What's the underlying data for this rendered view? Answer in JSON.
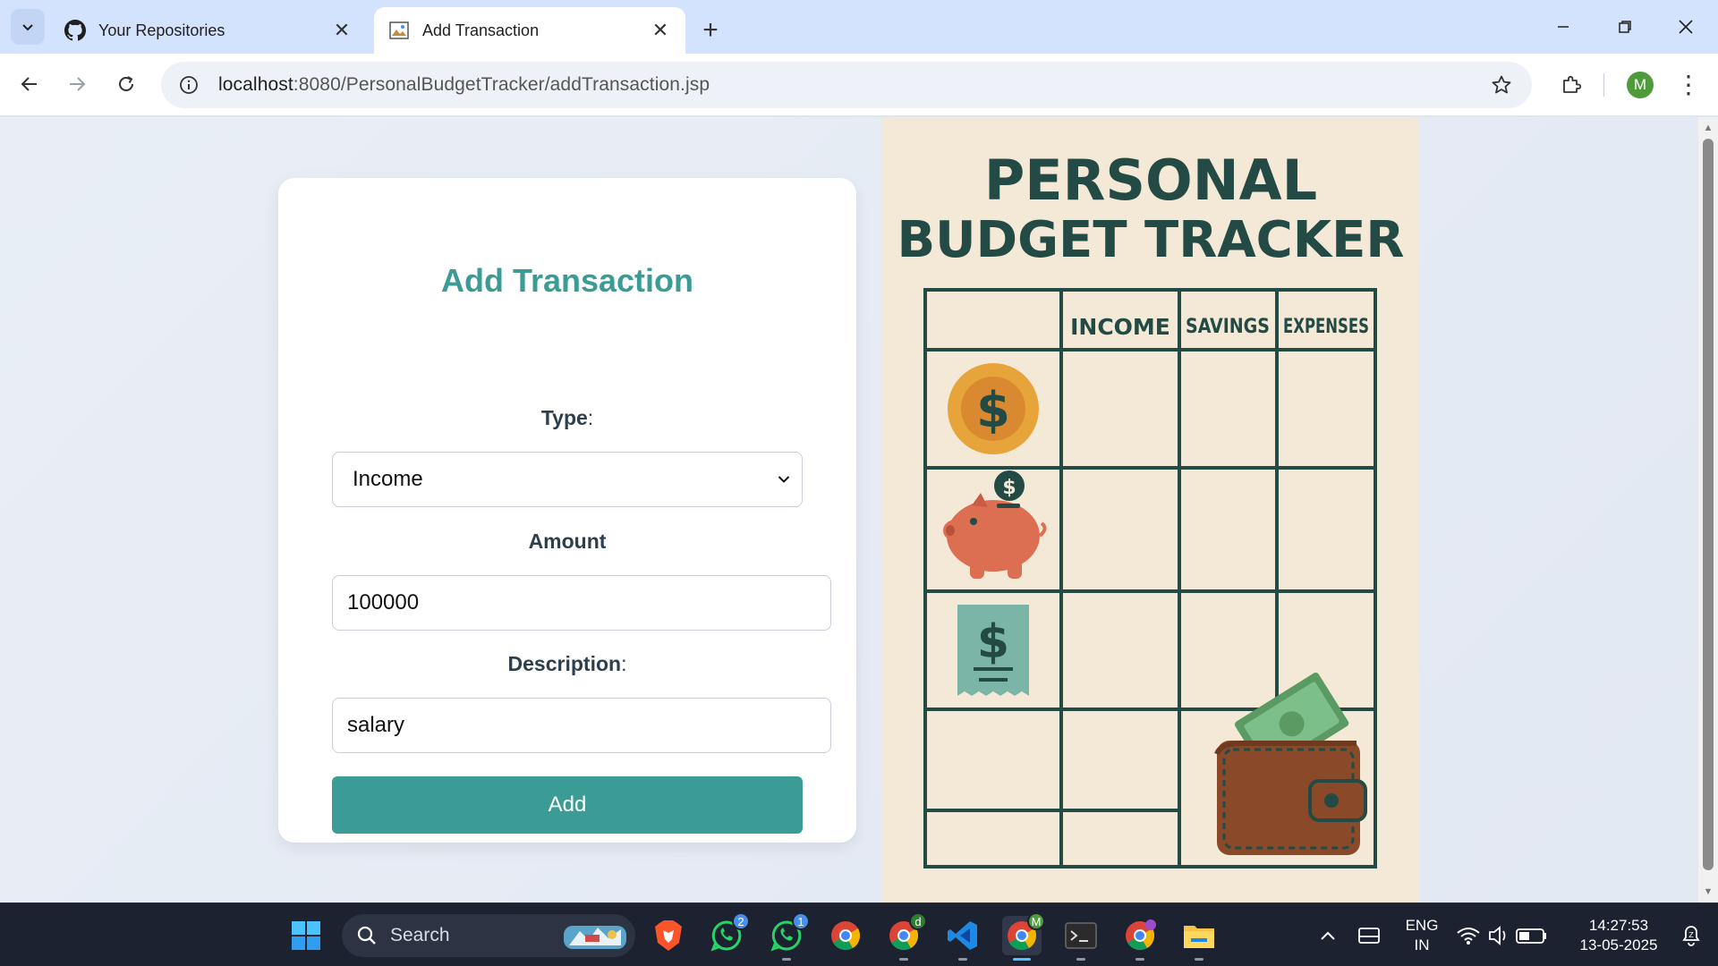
{
  "browser": {
    "tabs": [
      {
        "title": "Your Repositories",
        "icon": "github-icon",
        "active": false
      },
      {
        "title": "Add Transaction",
        "icon": "broken-image-icon",
        "active": true
      }
    ],
    "url_host": "localhost",
    "url_path": ":8080/PersonalBudgetTracker/addTransaction.jsp",
    "profile_initial": "M"
  },
  "form": {
    "title": "Add Transaction",
    "type_label": "Type",
    "type_colon": ":",
    "type_value": "Income",
    "amount_label": "Amount",
    "amount_value": "100000",
    "description_label": "Description",
    "description_colon": ":",
    "description_value": "salary",
    "submit_label": "Add"
  },
  "poster": {
    "title_line1": "PERSONAL",
    "title_line2": "BUDGET TRACKER",
    "columns": [
      "INCOME",
      "SAVINGS",
      "EXPENSES"
    ],
    "colors": {
      "ink": "#234a44",
      "background": "#f4e9d7",
      "coin": "#e7a43b",
      "piggy": "#dc6e52",
      "receipt": "#7ab5a8",
      "wallet": "#8a4a2a",
      "cash": "#7dbf8a"
    }
  },
  "taskbar": {
    "search_placeholder": "Search",
    "whatsapp_badge_1": "2",
    "whatsapp_badge_2": "1",
    "chrome_profile_d": "d",
    "chrome_profile_m": "M",
    "language_line1": "ENG",
    "language_line2": "IN",
    "time": "14:27:53",
    "date": "13-05-2025"
  },
  "colors": {
    "accent": "#3b9c96",
    "chrome_tabbar": "#d3e3fd",
    "taskbar": "#1c2230"
  }
}
